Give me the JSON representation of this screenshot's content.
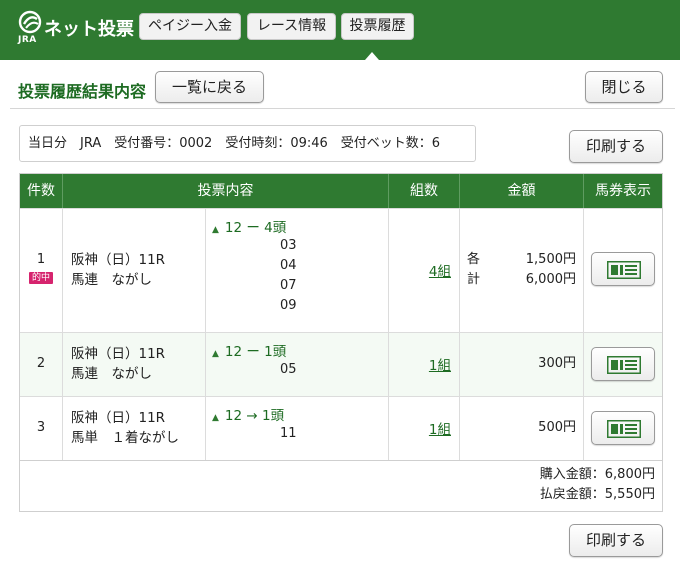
{
  "header": {
    "logo_text": "ネット投票",
    "logo_sub": "JRA",
    "nav": [
      {
        "label": "ペイジー入金"
      },
      {
        "label": "レース情報"
      },
      {
        "label": "投票履歴"
      }
    ]
  },
  "panel": {
    "title": "投票履歴結果内容",
    "back_label": "一覧に戻る",
    "close_label": "閉じる",
    "print_label": "印刷する",
    "print_bottom_label": "印刷する"
  },
  "info": {
    "text": "当日分　JRA　受付番号：0002　受付時刻：09:46　受付ベット数：6"
  },
  "table": {
    "headers": {
      "count": "件数",
      "content": "投票内容",
      "combos": "組数",
      "amount": "金額",
      "ticket": "馬券表示"
    },
    "rows": [
      {
        "no": "1",
        "hit": "的中",
        "race": "阪神（日）11R",
        "bet_type": "馬連　ながし",
        "arrow": "▲",
        "combo_head": "12 ー 4頭",
        "selections": [
          "03",
          "04",
          "07",
          "09"
        ],
        "combos": "4組",
        "amount_label_each": "各",
        "amount_each": "1,500円",
        "amount_label_total": "計",
        "amount_total": "6,000円"
      },
      {
        "no": "2",
        "race": "阪神（日）11R",
        "bet_type": "馬連　ながし",
        "arrow": "▲",
        "combo_head": "12 ー 1頭",
        "selections": [
          "05"
        ],
        "combos": "1組",
        "amount": "300円"
      },
      {
        "no": "3",
        "race": "阪神（日）11R",
        "bet_type": "馬単　１着ながし",
        "arrow": "▲",
        "combo_head": "12 → 1頭",
        "selections": [
          "11"
        ],
        "combos": "1組",
        "amount": "500円"
      }
    ]
  },
  "summary": {
    "purchase": "購入金額：6,800円",
    "refund": "払戻金額：5,550円"
  },
  "colors": {
    "brand_green": "#2f7a31",
    "hit_badge": "#d6246e"
  },
  "icons": {
    "logo": "jra-logo-icon",
    "ticket": "ticket-view-icon"
  }
}
